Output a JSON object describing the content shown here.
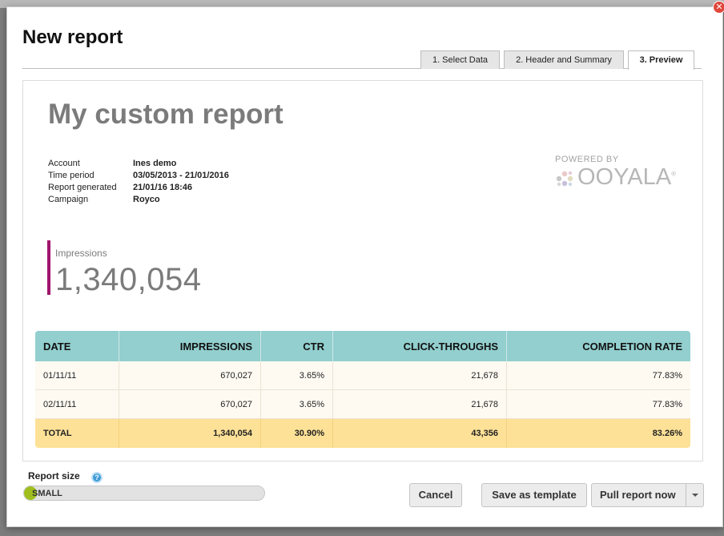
{
  "dialog": {
    "title": "New report",
    "close_glyph": "✕",
    "tabs": [
      {
        "label": "1. Select Data",
        "active": false
      },
      {
        "label": "2. Header and Summary",
        "active": false
      },
      {
        "label": "3. Preview",
        "active": true
      }
    ]
  },
  "report": {
    "title": "My custom report",
    "meta": [
      {
        "label": "Account",
        "value": "Ines demo"
      },
      {
        "label": "Time period",
        "value": "03/05/2013 - 21/01/2016"
      },
      {
        "label": "Report generated",
        "value": "21/01/16 18:46"
      },
      {
        "label": "Campaign",
        "value": "Royco"
      }
    ],
    "logo": {
      "powered_by": "POWERED BY",
      "brand": "OOYALA",
      "trademark": "®",
      "icon": "ooyala-dots-logo"
    },
    "metric": {
      "label": "Impressions",
      "value": "1,340,054",
      "accent_color": "#a0146d"
    },
    "table": {
      "headers": [
        "DATE",
        "IMPRESSIONS",
        "CTR",
        "CLICK-THROUGHS",
        "COMPLETION RATE"
      ],
      "rows": [
        [
          "01/11/11",
          "670,027",
          "3.65%",
          "21,678",
          "77.83%"
        ],
        [
          "02/11/11",
          "670,027",
          "3.65%",
          "21,678",
          "77.83%"
        ]
      ],
      "total": [
        "TOTAL",
        "1,340,054",
        "30.90%",
        "43,356",
        "83.26%"
      ],
      "header_color": "#92cfce",
      "total_color": "#fde197"
    }
  },
  "footer": {
    "report_size_label": "Report size",
    "help_icon": "question-icon",
    "help_glyph": "?",
    "size_value": "SMALL",
    "size_fill_fraction": 0.04,
    "buttons": {
      "cancel": "Cancel",
      "save_template": "Save as template",
      "pull_report": "Pull report now"
    }
  }
}
